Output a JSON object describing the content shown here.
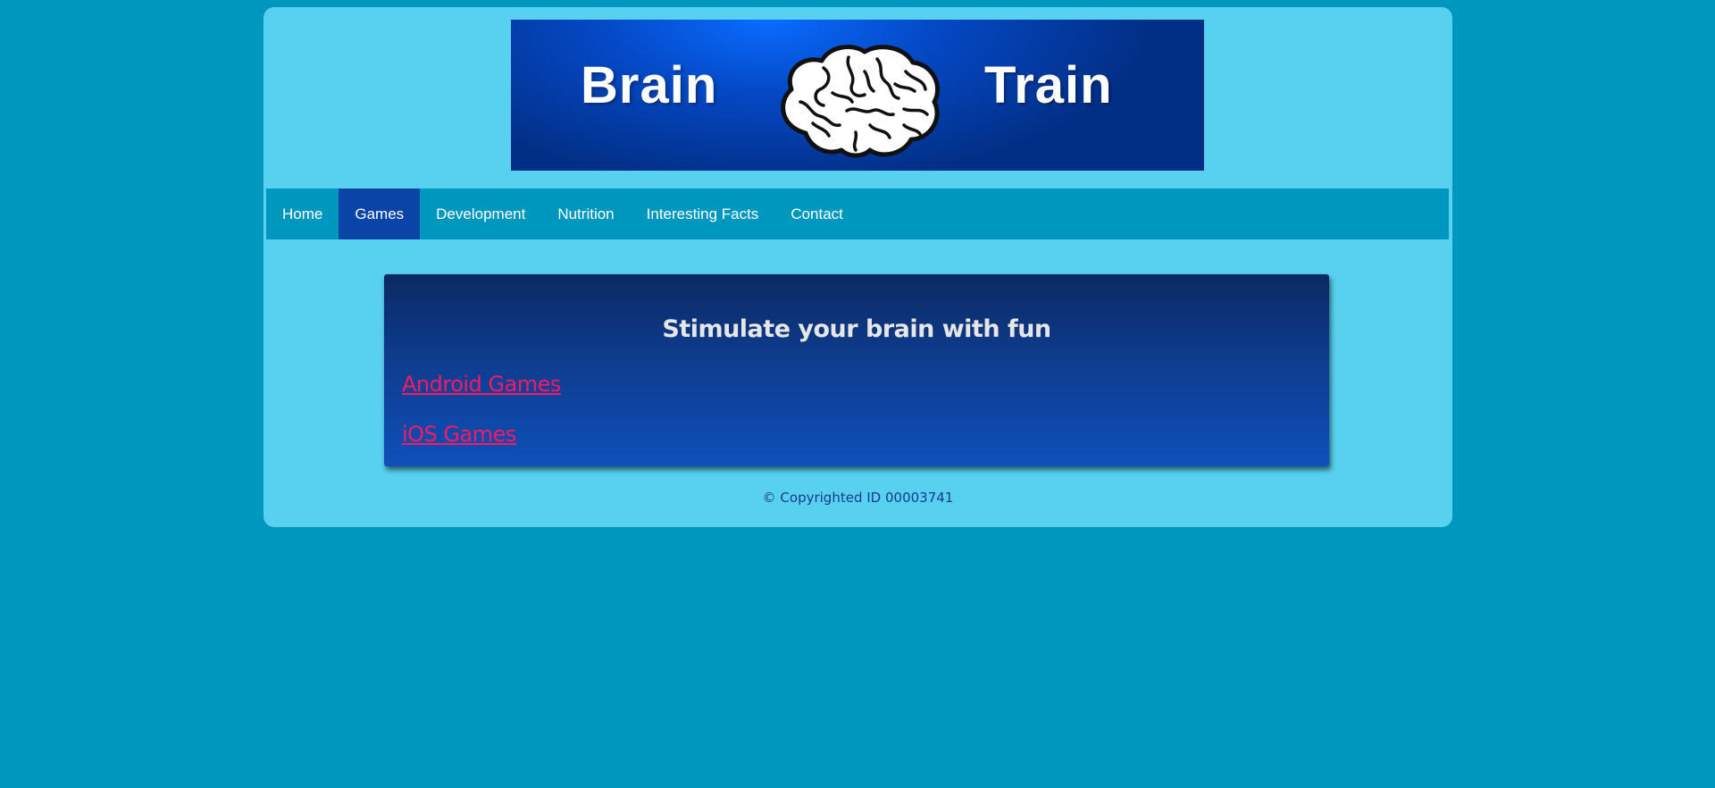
{
  "banner": {
    "word_left": "Brain",
    "word_right": "Train",
    "icon": "brain-icon"
  },
  "nav": {
    "items": [
      {
        "label": "Home",
        "active": false
      },
      {
        "label": "Games",
        "active": true
      },
      {
        "label": "Development",
        "active": false
      },
      {
        "label": "Nutrition",
        "active": false
      },
      {
        "label": "Interesting Facts",
        "active": false
      },
      {
        "label": "Contact",
        "active": false
      }
    ]
  },
  "main": {
    "title": "Stimulate your brain with fun",
    "links": [
      {
        "label": "Android Games"
      },
      {
        "label": "iOS Games"
      }
    ]
  },
  "footer": {
    "text": "© Copyrighted ID 00003741"
  },
  "colors": {
    "page_background": "#0097be",
    "container_background": "#58d0ef",
    "nav_active": "#0a44a6",
    "link": "#ff1760",
    "panel_top": "#0b2a63",
    "panel_bottom": "#0e50b9"
  }
}
